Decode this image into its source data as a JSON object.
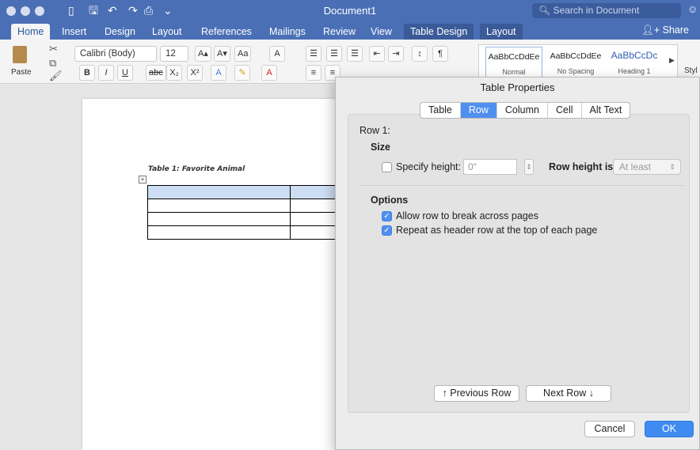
{
  "window": {
    "title": "Document1",
    "search_placeholder": "Search in Document",
    "quick_access": [
      "sidebar-icon",
      "save-icon",
      "undo-icon",
      "redo-icon",
      "print-icon",
      "customize-icon"
    ]
  },
  "ribbon": {
    "tabs": [
      {
        "label": "Home",
        "active": true
      },
      {
        "label": "Insert"
      },
      {
        "label": "Design"
      },
      {
        "label": "Layout"
      },
      {
        "label": "References"
      },
      {
        "label": "Mailings"
      },
      {
        "label": "Review"
      },
      {
        "label": "View"
      },
      {
        "label": "Table Design",
        "contextual": true
      },
      {
        "label": "Layout"
      }
    ],
    "share_label": "Share",
    "paste_label": "Paste",
    "font_name": "Calibri (Body)",
    "font_size": "12",
    "format_buttons": [
      "B",
      "I",
      "U",
      "abc",
      "X₂",
      "X²"
    ],
    "styles": [
      {
        "sample": "AaBbCcDdEe",
        "name": "Normal"
      },
      {
        "sample": "AaBbCcDdEe",
        "name": "No Spacing"
      },
      {
        "sample": "AaBbCcDc",
        "name": "Heading 1"
      }
    ],
    "styles_pane_label": "Styl"
  },
  "document": {
    "caption": "Table 1: Favorite Animal",
    "table_rows": 4,
    "selected_row": 1
  },
  "dialog": {
    "title": "Table Properties",
    "tabs": [
      {
        "label": "Table"
      },
      {
        "label": "Row",
        "active": true
      },
      {
        "label": "Column"
      },
      {
        "label": "Cell"
      },
      {
        "label": "Alt Text"
      }
    ],
    "row_label": "Row 1:",
    "size_heading": "Size",
    "specify_height_label": "Specify height:",
    "specify_height_checked": false,
    "height_value": "0\"",
    "row_height_is_label": "Row height is:",
    "row_height_is_value": "At least",
    "options_heading": "Options",
    "allow_break_label": "Allow row to break across pages",
    "allow_break_checked": true,
    "repeat_header_label": "Repeat as header row at the top of each page",
    "repeat_header_checked": true,
    "prev_row_label": "↑  Previous Row",
    "next_row_label": "Next Row  ↓",
    "cancel_label": "Cancel",
    "ok_label": "OK"
  },
  "colors": {
    "accent": "#4a6fb5",
    "selection": "#cdddf3",
    "primary_button": "#3f8bf2"
  }
}
